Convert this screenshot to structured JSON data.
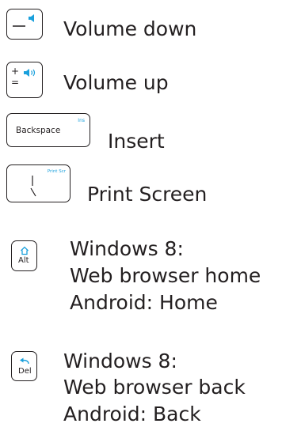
{
  "accent": "#1aa0dc",
  "keys": [
    {
      "description": "Volume down",
      "icons": [
        "minus-icon",
        "speaker-icon"
      ]
    },
    {
      "description": "Volume up",
      "key_symbol_plus": "+",
      "key_symbol_equals": "=",
      "icons": [
        "speaker-loud-icon"
      ]
    },
    {
      "description": "Insert",
      "key_label": "Backspace",
      "corner_label": "Ins"
    },
    {
      "description": "Print Screen",
      "corner_label": "Print Scr",
      "icons": [
        "pipe-backslash-icon"
      ]
    },
    {
      "description_lines": [
        "Windows 8:",
        "Web browser home",
        "Android: Home"
      ],
      "key_label": "Alt",
      "icons": [
        "home-icon"
      ]
    },
    {
      "description_lines": [
        "Windows 8:",
        "Web browser back",
        "Android: Back"
      ],
      "key_label": "Del",
      "icons": [
        "back-arrow-icon"
      ]
    }
  ]
}
